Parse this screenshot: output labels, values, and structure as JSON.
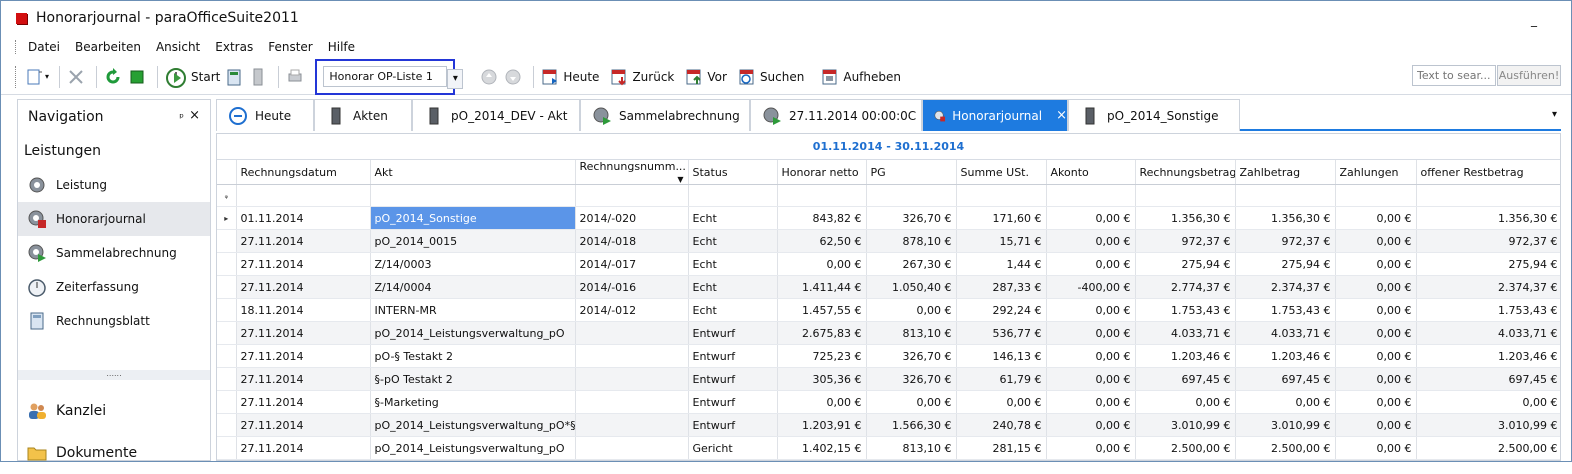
{
  "window": {
    "title": "Honorarjournal - paraOfficeSuite2011",
    "min_glyph": "_"
  },
  "menu": [
    "Datei",
    "Bearbeiten",
    "Ansicht",
    "Extras",
    "Fenster",
    "Hilfe"
  ],
  "toolbar": {
    "start": "Start",
    "combo_value": "Honorar OP-Liste 1",
    "heute": "Heute",
    "zurueck": "Zurück",
    "vor": "Vor",
    "suchen": "Suchen",
    "aufheben": "Aufheben",
    "search_placeholder": "Text to sear...",
    "search_button": "Ausführen!"
  },
  "nav": {
    "title": "Navigation",
    "group": "Leistungen",
    "items": [
      "Leistung",
      "Honorarjournal",
      "Sammelabrechnung",
      "Zeiterfassung",
      "Rechnungsblatt"
    ],
    "splitter": "......",
    "bottom": [
      "Kanzlei",
      "Dokumente"
    ]
  },
  "tabs": [
    "Heute",
    "Akten",
    "pO_2014_DEV - Akt",
    "Sammelabrechnung",
    "27.11.2014 00:00:0C",
    "Honorarjournal",
    "pO_2014_Sonstige"
  ],
  "tab_close": "×",
  "grid": {
    "period": "01.11.2014 - 30.11.2014",
    "columns": [
      "Rechnungsdatum",
      "Akt",
      "Rechnungsnumm...",
      "Status",
      "Honorar netto",
      "PG",
      "Summe USt.",
      "Akonto",
      "Rechnungsbetrag",
      "Zahlbetrag",
      "Zahlungen",
      "offener Restbetrag"
    ],
    "rows": [
      [
        "01.11.2014",
        "pO_2014_Sonstige",
        "2014/-020",
        "Echt",
        "843,82 €",
        "326,70 €",
        "171,60 €",
        "0,00 €",
        "1.356,30 €",
        "1.356,30 €",
        "0,00 €",
        "1.356,30 €"
      ],
      [
        "27.11.2014",
        "pO_2014_0015",
        "2014/-018",
        "Echt",
        "62,50 €",
        "878,10 €",
        "15,71 €",
        "0,00 €",
        "972,37 €",
        "972,37 €",
        "0,00 €",
        "972,37 €"
      ],
      [
        "27.11.2014",
        "Z/14/0003",
        "2014/-017",
        "Echt",
        "0,00 €",
        "267,30 €",
        "1,44 €",
        "0,00 €",
        "275,94 €",
        "275,94 €",
        "0,00 €",
        "275,94 €"
      ],
      [
        "27.11.2014",
        "Z/14/0004",
        "2014/-016",
        "Echt",
        "1.411,44 €",
        "1.050,40 €",
        "287,33 €",
        "-400,00 €",
        "2.774,37 €",
        "2.374,37 €",
        "0,00 €",
        "2.374,37 €"
      ],
      [
        "18.11.2014",
        "INTERN-MR",
        "2014/-012",
        "Echt",
        "1.457,55 €",
        "0,00 €",
        "292,24 €",
        "0,00 €",
        "1.753,43 €",
        "1.753,43 €",
        "0,00 €",
        "1.753,43 €"
      ],
      [
        "27.11.2014",
        "pO_2014_Leistungsverwaltung_pO",
        "",
        "Entwurf",
        "2.675,83 €",
        "813,10 €",
        "536,77 €",
        "0,00 €",
        "4.033,71 €",
        "4.033,71 €",
        "0,00 €",
        "4.033,71 €"
      ],
      [
        "27.11.2014",
        "pO-§ Testakt 2",
        "",
        "Entwurf",
        "725,23 €",
        "326,70 €",
        "146,13 €",
        "0,00 €",
        "1.203,46 €",
        "1.203,46 €",
        "0,00 €",
        "1.203,46 €"
      ],
      [
        "27.11.2014",
        "§-pO Testakt 2",
        "",
        "Entwurf",
        "305,36 €",
        "326,70 €",
        "61,79 €",
        "0,00 €",
        "697,45 €",
        "697,45 €",
        "0,00 €",
        "697,45 €"
      ],
      [
        "27.11.2014",
        "§-Marketing",
        "",
        "Entwurf",
        "0,00 €",
        "0,00 €",
        "0,00 €",
        "0,00 €",
        "0,00 €",
        "0,00 €",
        "0,00 €",
        "0,00 €"
      ],
      [
        "27.11.2014",
        "pO_2014_Leistungsverwaltung_pO*§",
        "",
        "Entwurf",
        "1.203,91 €",
        "1.566,30 €",
        "240,78 €",
        "0,00 €",
        "3.010,99 €",
        "3.010,99 €",
        "0,00 €",
        "3.010,99 €"
      ],
      [
        "27.11.2014",
        "pO_2014_Leistungsverwaltung_pO",
        "",
        "Gericht",
        "1.402,15 €",
        "813,10 €",
        "281,15 €",
        "0,00 €",
        "2.500,00 €",
        "2.500,00 €",
        "0,00 €",
        "2.500,00 €"
      ]
    ]
  }
}
